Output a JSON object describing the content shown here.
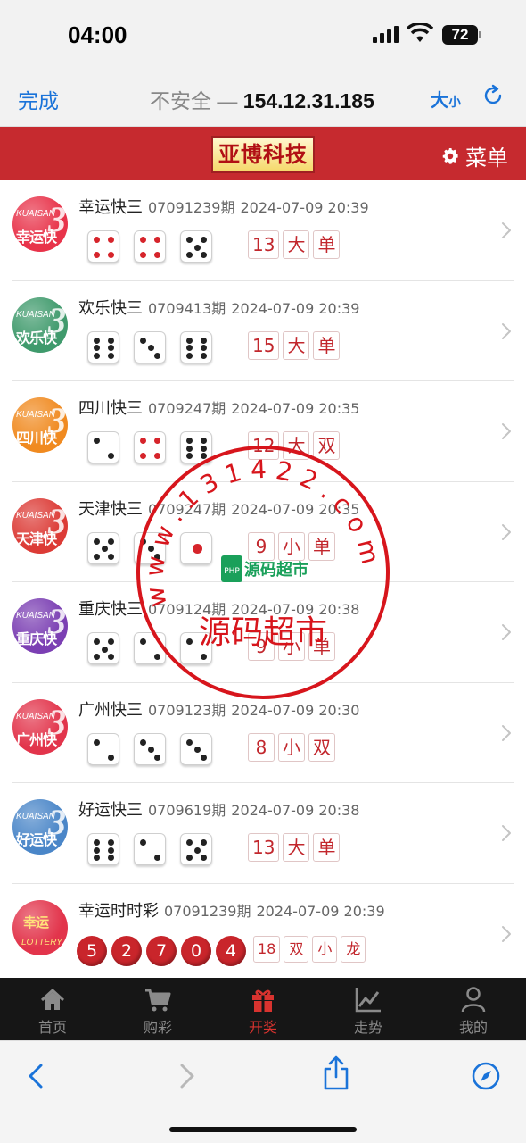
{
  "status_bar": {
    "time": "04:00",
    "battery": "72"
  },
  "browser": {
    "done_label": "完成",
    "insecure_label": "不安全 — ",
    "host": "154.12.31.185",
    "text_size_big": "大",
    "text_size_small": "小"
  },
  "header": {
    "logo_text": "亚博科技",
    "menu_label": "菜单"
  },
  "lotteries": [
    {
      "name": "幸运快三",
      "period": "07091239期",
      "time": "2024-07-09 20:39",
      "icon_name": "幸运快",
      "icon_color": "#e8334a",
      "dice": [
        4,
        4,
        5
      ],
      "red": [
        true,
        true,
        false
      ],
      "sum": "13",
      "size": "大",
      "parity": "单"
    },
    {
      "name": "欢乐快三",
      "period": "0709413期",
      "time": "2024-07-09 20:39",
      "icon_name": "欢乐快",
      "icon_color": "#3f9a6c",
      "dice": [
        6,
        3,
        6
      ],
      "red": [
        false,
        false,
        false
      ],
      "sum": "15",
      "size": "大",
      "parity": "单"
    },
    {
      "name": "四川快三",
      "period": "0709247期",
      "time": "2024-07-09 20:35",
      "icon_name": "四川快",
      "icon_color": "#f08a20",
      "dice": [
        2,
        4,
        6
      ],
      "red": [
        false,
        true,
        false
      ],
      "sum": "12",
      "size": "大",
      "parity": "双"
    },
    {
      "name": "天津快三",
      "period": "0709247期",
      "time": "2024-07-09 20:35",
      "icon_name": "天津快",
      "icon_color": "#dc3b36",
      "dice": [
        5,
        3,
        1
      ],
      "red": [
        false,
        false,
        true
      ],
      "sum": "9",
      "size": "小",
      "parity": "单"
    },
    {
      "name": "重庆快三",
      "period": "0709124期",
      "time": "2024-07-09 20:38",
      "icon_name": "重庆快",
      "icon_color": "#7b3fb3",
      "dice": [
        5,
        2,
        2
      ],
      "red": [
        false,
        false,
        false
      ],
      "sum": "9",
      "size": "小",
      "parity": "单"
    },
    {
      "name": "广州快三",
      "period": "0709123期",
      "time": "2024-07-09 20:30",
      "icon_name": "广州快",
      "icon_color": "#e2344b",
      "dice": [
        2,
        3,
        3
      ],
      "red": [
        false,
        false,
        false
      ],
      "sum": "8",
      "size": "小",
      "parity": "双"
    },
    {
      "name": "好运快三",
      "period": "0709619期",
      "time": "2024-07-09 20:38",
      "icon_name": "好运快",
      "icon_color": "#4a86c8",
      "dice": [
        6,
        2,
        5
      ],
      "red": [
        false,
        false,
        false
      ],
      "sum": "13",
      "size": "大",
      "parity": "单"
    }
  ],
  "ssc": {
    "name": "幸运时时彩",
    "period": "07091239期",
    "time": "2024-07-09 20:39",
    "icon_text": "幸运",
    "balls": [
      "5",
      "2",
      "7",
      "0",
      "4"
    ],
    "sum": "18",
    "tags": [
      "双",
      "小",
      "龙"
    ]
  },
  "watermark": {
    "ring_text": "w w w . 1 3 1 4 2 2 . c o m",
    "center": "源码超市",
    "bottom": "源码超市",
    "logo": "PHP"
  },
  "tabs": [
    {
      "label": "首页",
      "icon": "home-icon",
      "active": false
    },
    {
      "label": "购彩",
      "icon": "cart-icon",
      "active": false
    },
    {
      "label": "开奖",
      "icon": "gift-icon",
      "active": true
    },
    {
      "label": "走势",
      "icon": "trend-icon",
      "active": false
    },
    {
      "label": "我的",
      "icon": "user-icon",
      "active": false
    }
  ],
  "colors": {
    "brand_red": "#c62a2f",
    "link_blue": "#1a73d9",
    "tab_active": "#d8332f"
  }
}
